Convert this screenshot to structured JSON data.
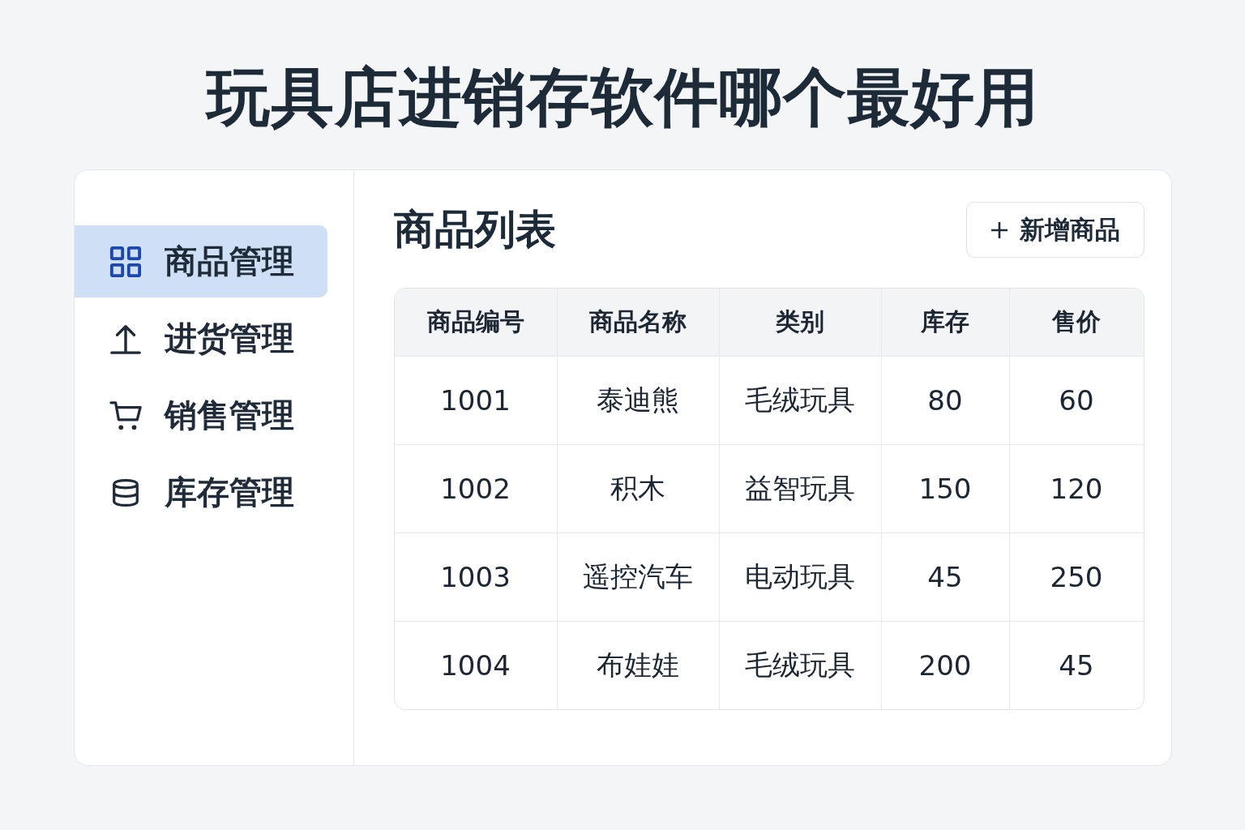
{
  "title": "玩具店进销存软件哪个最好用",
  "sidebar": {
    "items": [
      {
        "label": "商品管理",
        "selected": true
      },
      {
        "label": "进货管理",
        "selected": false
      },
      {
        "label": "销售管理",
        "selected": false
      },
      {
        "label": "库存管理",
        "selected": false
      }
    ]
  },
  "main": {
    "heading": "商品列表",
    "add_button": {
      "label": "新增商品"
    },
    "table": {
      "columns": [
        "商品编号",
        "商品名称",
        "类别",
        "库存",
        "售价"
      ],
      "rows": [
        [
          "1001",
          "泰迪熊",
          "毛绒玩具",
          "80",
          "60"
        ],
        [
          "1002",
          "积木",
          "益智玩具",
          "150",
          "120"
        ],
        [
          "1003",
          "遥控汽车",
          "电动玩具",
          "45",
          "250"
        ],
        [
          "1004",
          "布娃娃",
          "毛绒玩具",
          "200",
          "45"
        ]
      ]
    }
  }
}
